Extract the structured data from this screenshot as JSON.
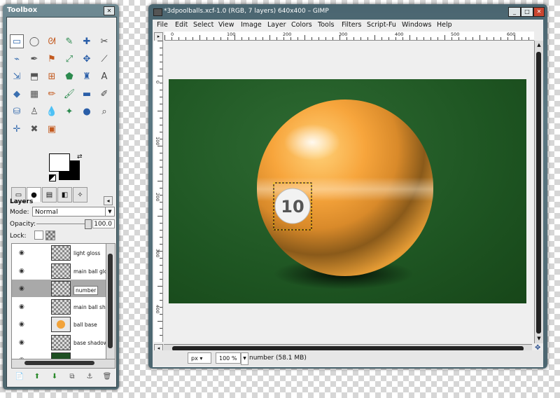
{
  "toolbox": {
    "title": "Toolbox",
    "tools": [
      "▭",
      "◯",
      "ᘛ",
      "✎",
      "✚",
      "✂",
      "⌁",
      "✒",
      "⚑",
      "⤢",
      "✥",
      "⟋",
      "⇲",
      "⬒",
      "⊞",
      "⬟",
      "♜",
      "A",
      "◆",
      "▦",
      "✏",
      "🖌",
      "▬",
      "✐",
      "⛁",
      "♙",
      "💧",
      "✦",
      "●",
      "⌕",
      "✛",
      "✖",
      "▣"
    ],
    "tool_names": [
      "rect-select-icon",
      "ellipse-select-icon",
      "lasso-icon",
      "fuzzy-select-icon",
      "color-select-icon",
      "scissors-icon",
      "paths-icon",
      "color-picker-icon",
      "align-icon",
      "move-icon",
      "crop-icon",
      "rotate-icon",
      "scale-icon",
      "shear-icon",
      "perspective-icon",
      "flip-icon",
      "text-icon-unused",
      "text-icon",
      "bucket-fill-icon",
      "blend-icon",
      "pencil-icon",
      "paintbrush-icon",
      "eraser-icon",
      "airbrush-icon",
      "ink-icon",
      "clone-icon",
      "blur-icon",
      "smudge-icon",
      "dodge-icon",
      "magnify-icon",
      "measure-icon",
      "heal-icon",
      "cage-icon"
    ],
    "colors": {
      "fg": "#ffffff",
      "bg": "#000000"
    }
  },
  "layers_panel": {
    "title": "Layers",
    "mode_label": "Mode:",
    "mode_value": "Normal",
    "opacity_label": "Opacity:",
    "opacity_value": "100.0",
    "lock_label": "Lock:",
    "layers": [
      {
        "name": "light gloss",
        "selected": false
      },
      {
        "name": "main ball glo",
        "selected": false
      },
      {
        "name": "number",
        "selected": true
      },
      {
        "name": "main ball sha",
        "selected": false
      },
      {
        "name": "ball base",
        "selected": false
      },
      {
        "name": "base shadow",
        "selected": false
      },
      {
        "name": "",
        "selected": false
      }
    ],
    "bottom_buttons": [
      "📄",
      "⬆",
      "⬇",
      "⧉",
      "⚓",
      "🗑"
    ]
  },
  "window": {
    "title": "*3dpoolballs.xcf-1.0 (RGB, 7 layers) 640x400 – GIMP",
    "menus": [
      "File",
      "Edit",
      "Select",
      "View",
      "Image",
      "Layer",
      "Colors",
      "Tools",
      "Filters",
      "Script-Fu",
      "Windows",
      "Help"
    ],
    "ruler_h": [
      "0",
      "100",
      "200",
      "300",
      "400",
      "500",
      "600"
    ],
    "ruler_v": [
      "0",
      "100",
      "200",
      "300",
      "400"
    ],
    "ball_number": "10",
    "unit": "px",
    "zoom": "100 %",
    "status": "number (58.1 MB)"
  }
}
